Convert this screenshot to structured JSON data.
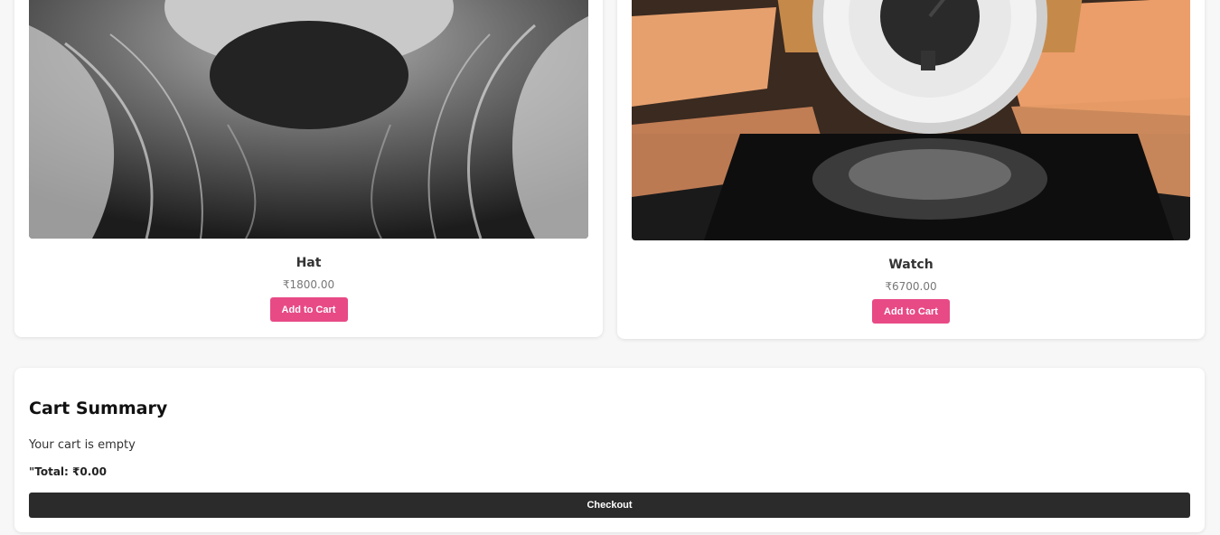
{
  "products": [
    {
      "name": "Hat",
      "price": "₹1800.00",
      "button_label": "Add to Cart",
      "image": "woman-portrait-photo"
    },
    {
      "name": "Watch",
      "price": "₹6700.00",
      "button_label": "Add to Cart",
      "image": "wristwatch-photo"
    }
  ],
  "cart": {
    "title": "Cart Summary",
    "empty_message": "Your cart is empty",
    "total": "\"Total: ₹0.00",
    "checkout_label": "Checkout"
  },
  "colors": {
    "accent": "#e84a86",
    "checkout": "#2b2b2b",
    "background": "#f7f7f7"
  }
}
